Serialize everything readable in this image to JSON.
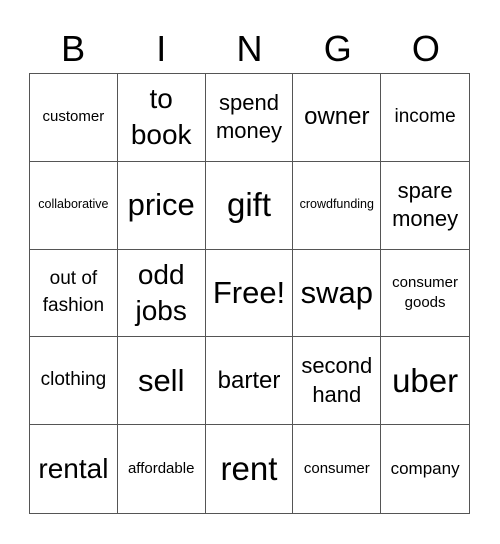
{
  "header": [
    "B",
    "I",
    "N",
    "G",
    "O"
  ],
  "cells": [
    "customer",
    "to book",
    "spend money",
    "owner",
    "income",
    "collaborative",
    "price",
    "gift",
    "crowdfunding",
    "spare money",
    "out of fashion",
    "odd jobs",
    "Free!",
    "swap",
    "consumer goods",
    "clothing",
    "sell",
    "barter",
    "second hand",
    "uber",
    "rental",
    "affordable",
    "rent",
    "consumer",
    "company"
  ]
}
